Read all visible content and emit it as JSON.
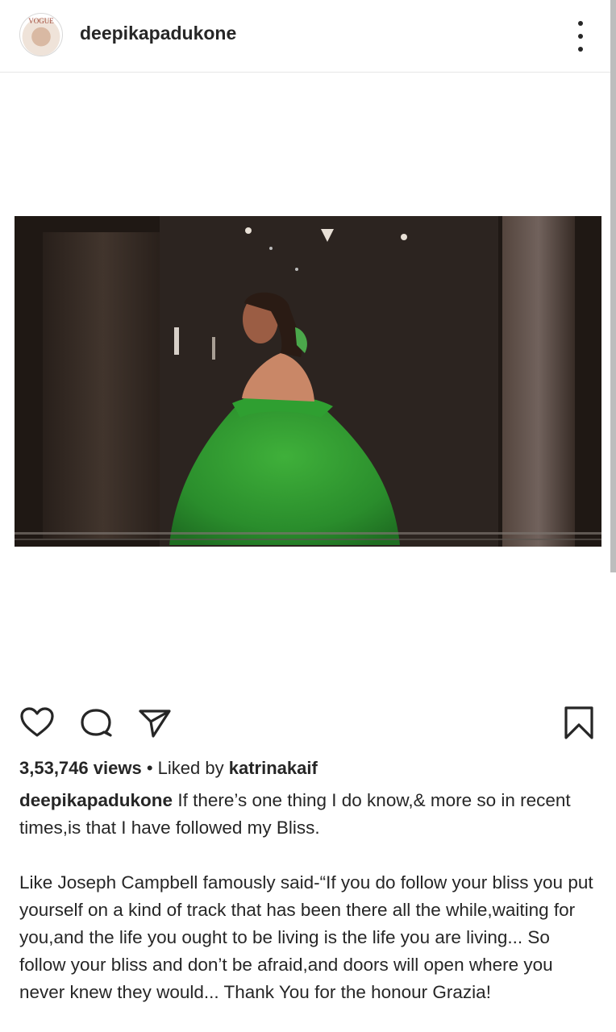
{
  "post": {
    "username": "deepikapadukone",
    "avatar_text": "VOGUE",
    "views": "3,53,746 views",
    "separator": "•",
    "liked_by_prefix": "Liked by",
    "liked_by_user": "katrinakaif",
    "caption_user": "deepikapadukone",
    "caption_line1": " If there’s one thing I do know,& more so in recent times,is that I have followed my Bliss.",
    "caption_para2": "Like Joseph Campbell famously said-“If you do follow your bliss you put yourself on a kind of track that has been there all the while,waiting for you,and the life you ought to be living is the life you are living... So follow your bliss and don’t be afraid,and doors will open where you never knew they would... Thank You for the honour Grazia!"
  },
  "icons": {
    "more": "more-options-icon",
    "like": "heart-icon",
    "comment": "comment-icon",
    "share": "share-icon",
    "save": "bookmark-icon"
  },
  "colors": {
    "text": "#262626",
    "dress": "#2e9a2e",
    "video_background": "#1d1613"
  }
}
